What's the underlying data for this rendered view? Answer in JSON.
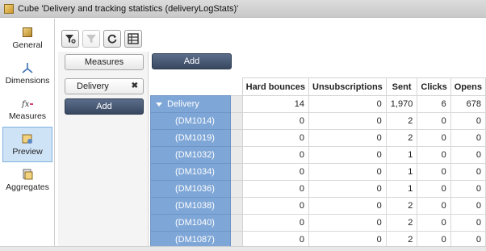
{
  "window": {
    "title": "Cube 'Delivery and tracking statistics (deliveryLogStats)'"
  },
  "nav": {
    "items": [
      {
        "label": "General",
        "icon": "cube-icon",
        "active": false
      },
      {
        "label": "Dimensions",
        "icon": "dimensions-icon",
        "active": false
      },
      {
        "label": "Measures",
        "icon": "measures-icon",
        "active": false
      },
      {
        "label": "Preview",
        "icon": "preview-icon",
        "active": true
      },
      {
        "label": "Aggregates",
        "icon": "aggregates-icon",
        "active": false
      }
    ]
  },
  "toolbar": {
    "buttons": [
      {
        "icon": "funnel-add-icon",
        "enabled": true
      },
      {
        "icon": "funnel-icon",
        "enabled": false
      },
      {
        "icon": "refresh-icon",
        "enabled": true
      },
      {
        "icon": "table-settings-icon",
        "enabled": true
      }
    ]
  },
  "panel": {
    "measures_label": "Measures",
    "dimension_chip": "Delivery",
    "add_left_label": "Add",
    "add_top_label": "Add"
  },
  "table": {
    "columns": [
      "Hard bounces",
      "Unsubscriptions",
      "Sent",
      "Clicks",
      "Opens"
    ],
    "parent": {
      "label": "Delivery",
      "values": [
        "14",
        "0",
        "1,970",
        "6",
        "678"
      ]
    },
    "rows": [
      {
        "label": "(DM1014)",
        "values": [
          "0",
          "0",
          "2",
          "0",
          "0"
        ]
      },
      {
        "label": "(DM1019)",
        "values": [
          "0",
          "0",
          "2",
          "0",
          "0"
        ]
      },
      {
        "label": "(DM1032)",
        "values": [
          "0",
          "0",
          "1",
          "0",
          "0"
        ]
      },
      {
        "label": "(DM1034)",
        "values": [
          "0",
          "0",
          "1",
          "0",
          "0"
        ]
      },
      {
        "label": "(DM1036)",
        "values": [
          "0",
          "0",
          "1",
          "0",
          "0"
        ]
      },
      {
        "label": "(DM1038)",
        "values": [
          "0",
          "0",
          "2",
          "0",
          "0"
        ]
      },
      {
        "label": "(DM1040)",
        "values": [
          "0",
          "0",
          "2",
          "0",
          "0"
        ]
      },
      {
        "label": "(DM1087)",
        "values": [
          "0",
          "0",
          "2",
          "0",
          "0"
        ]
      }
    ]
  }
}
